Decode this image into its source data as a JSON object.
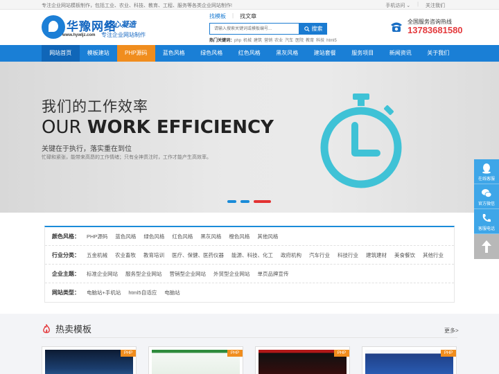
{
  "topbar": {
    "intro": "专注企业网站模板制作，包括工业、农业、科技、教育、工程、服务等各类企业网站制作!",
    "mobile": "手机访问 ⌄",
    "follow": "关注我们"
  },
  "logo": {
    "name": "华豫网络",
    "slogan": "匠心凝造",
    "url": "www.hywljz.com",
    "subtitle": "专注企业网站制作"
  },
  "search": {
    "tabs": [
      "找模板",
      "找文章"
    ],
    "placeholder": "请输入搜索关键词或模板编号...",
    "button": "搜索",
    "hot_label": "热门关键词：",
    "hot_words": [
      "php",
      "机械",
      "建筑",
      "营销",
      "农业",
      "汽车",
      "医院",
      "教育",
      "科技",
      "html5"
    ]
  },
  "hotline": {
    "label": "全国服务咨询热线",
    "number": "13783681580"
  },
  "nav": [
    "网站首页",
    "模板建站",
    "PHP源码",
    "蓝色风格",
    "绿色风格",
    "红色风格",
    "黑灰风格",
    "建站套餐",
    "服务项目",
    "新闻资讯",
    "关于我们"
  ],
  "banner": {
    "title_cn": "我们的工作效率",
    "title_en_1": "OUR ",
    "title_en_2": "WORK EFFICIENCY",
    "tagline": "关键在于执行，落实重在到位",
    "desc": "忙碌和紧张，能带来高昂的工作情绪；只有全神贯注时，工作才能产生高效率。",
    "slides": 3,
    "active_slide": 3
  },
  "filters": [
    {
      "label": "颜色风格：",
      "options": [
        "PHP源码",
        "蓝色风格",
        "绿色风格",
        "红色风格",
        "黑灰风格",
        "橙色风格",
        "其他风格"
      ]
    },
    {
      "label": "行业分类：",
      "options": [
        "五金机械",
        "农业畜牧",
        "教育培训",
        "医疗、保健、医药仪器",
        "能源、科技、化工",
        "政府机构",
        "汽车行业",
        "科技行业",
        "建筑建材",
        "美食餐饮",
        "其他行业"
      ]
    },
    {
      "label": "企业主题：",
      "options": [
        "标准企业网站",
        "服务型企业网站",
        "营销型企业网站",
        "外贸型企业网站",
        "单页品牌宣传"
      ]
    },
    {
      "label": "网站类型：",
      "options": [
        "电脑站+手机站",
        "html5自适应",
        "电脑站"
      ]
    }
  ],
  "hot_section": {
    "title": "热卖模板",
    "more": "更多>",
    "card_badge": "PHP",
    "cards": 4
  },
  "side": {
    "qq": "在线客服",
    "wechat": "官方微信",
    "phone": "客服电话"
  },
  "colors": {
    "brand_blue": "#1a7fd6",
    "accent_orange": "#f08d1e",
    "hotline_red": "#e4393c",
    "clock_cyan": "#3fc2d6",
    "side_blue": "#3ea6e8"
  },
  "icons": [
    "phone-icon",
    "search-icon",
    "clock-icon",
    "fire-icon",
    "qq-icon",
    "wechat-icon",
    "phone-call-icon",
    "arrow-up-icon"
  ]
}
